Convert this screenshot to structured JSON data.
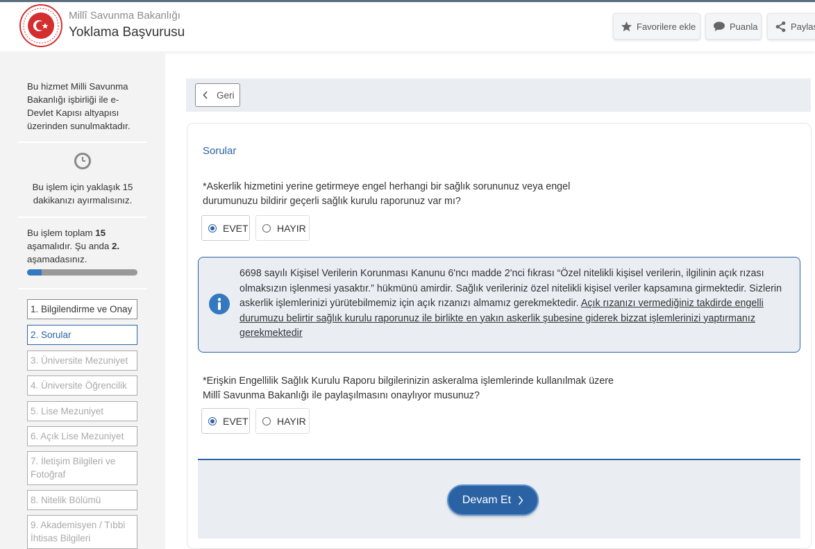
{
  "header": {
    "ministry": "Millî Savunma Bakanlığı",
    "service_title": "Yoklama Başvurusu",
    "buttons": {
      "favorite": "Favorilere ekle",
      "rate": "Puanla",
      "share": "Paylaş"
    }
  },
  "sidebar": {
    "info": "Bu hizmet Milli Savunma Bakanlığı işbirliği ile e-Devlet Kapısı altyapısı üzerinden sunulmaktadır.",
    "time": "Bu işlem için yaklaşık 15 dakikanızı ayırmalısınız.",
    "steps_a": "Bu işlem toplam ",
    "steps_total": "15",
    "steps_b": " aşamalıdır. Şu anda ",
    "steps_current": "2.",
    "steps_c": " aşamadasınız.",
    "progress_fraction": 0.133,
    "steps": [
      "1. Bilgilendirme ve Onay",
      "2. Sorular",
      "3. Üniversite Mezuniyet",
      "4. Üniversite Öğrencilik",
      "5. Lise Mezuniyet",
      "6. Açık Lise Mezuniyet",
      "7. İletişim Bilgileri ve Fotoğraf",
      "8. Nitelik Bölümü",
      "9. Akademisyen / Tıbbi İhtisas Bilgileri"
    ]
  },
  "main": {
    "back_label": "Geri",
    "section_title": "Sorular",
    "question1": "*Askerlik hizmetini yerine getirmeye engel herhangi bir sağlık sorununuz veya engel durumunuzu bildirir geçerli sağlık kurulu raporunuz var mı?",
    "question2": "*Erişkin Engellilik Sağlık Kurulu Raporu bilgilerinizin askeralma işlemlerinde kullanılmak üzere Millî Savunma Bakanlığı ile paylaşılmasını onaylıyor musunuz?",
    "yes": "EVET",
    "no": "HAYIR",
    "alert_plain": "6698 sayılı Kişisel Verilerin Korunması Kanunu 6'ncı madde 2'nci fıkrası “Özel nitelikli kişisel verilerin, ilgilinin açık rızası olmaksızın işlenmesi yasaktır.” hükmünü amirdir. Sağlık verileriniz özel nitelikli kişisel veriler kapsamına girmektedir. Sizlerin askerlik işlemlerinizi yürütebilmemiz için açık rızanızı almamız gerekmektedir. ",
    "alert_underlined": "Açık rızanızı vermediğiniz takdirde engelli durumuzu belirtir sağlık kurulu raporunuz ile birlikte en yakın askerlik şubesine giderek bizzat işlemlerinizi yaptırmanız gerekmektedir",
    "continue_label": "Devam Et"
  },
  "colors": {
    "primary": "#2a62a4",
    "panel": "#eaeef3",
    "sidebar_bg": "#f3f3f3"
  }
}
